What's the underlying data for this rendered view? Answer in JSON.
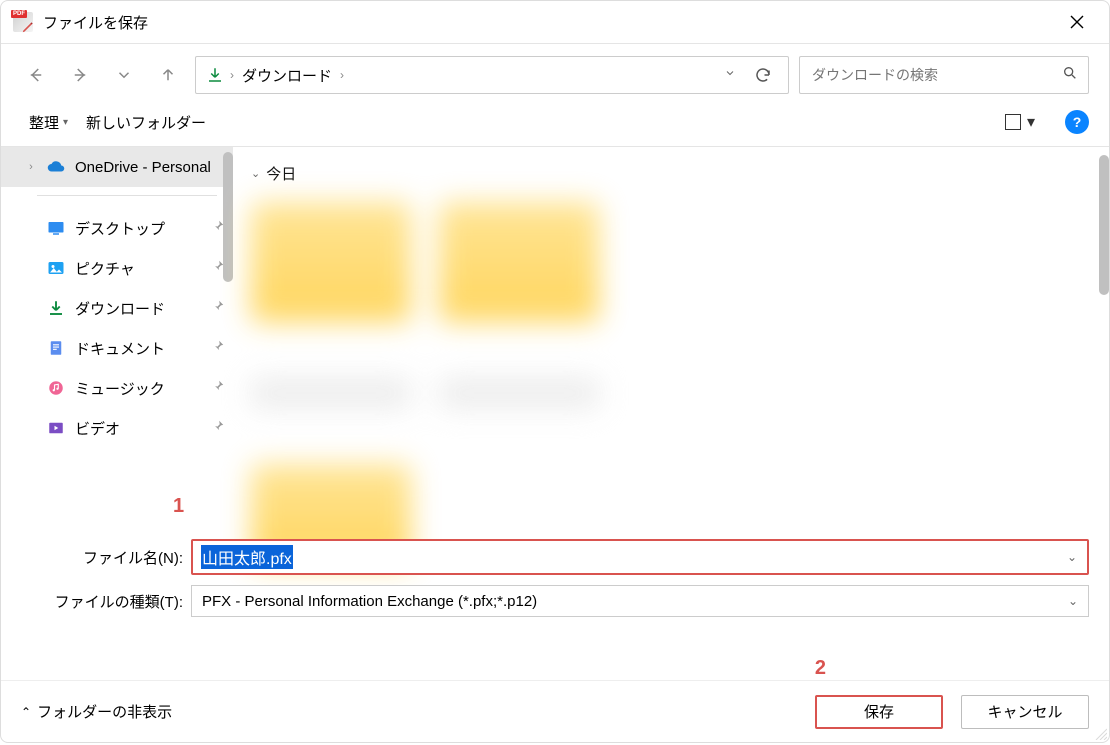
{
  "title": "ファイルを保存",
  "breadcrumb": {
    "item1": "ダウンロード"
  },
  "search": {
    "placeholder": "ダウンロードの検索"
  },
  "toolbar": {
    "organize": "整理",
    "newfolder": "新しいフォルダー"
  },
  "sidebar": {
    "onedrive": "OneDrive - Personal",
    "items": [
      {
        "label": "デスクトップ"
      },
      {
        "label": "ピクチャ"
      },
      {
        "label": "ダウンロード"
      },
      {
        "label": "ドキュメント"
      },
      {
        "label": "ミュージック"
      },
      {
        "label": "ビデオ"
      }
    ]
  },
  "content": {
    "group": "今日"
  },
  "filefields": {
    "name_label": "ファイル名(N):",
    "name_value": "山田太郎.pfx",
    "type_label": "ファイルの種類(T):",
    "type_value": "PFX - Personal Information Exchange (*.pfx;*.p12)"
  },
  "annotations": {
    "one": "1",
    "two": "2"
  },
  "footer": {
    "hide_folders": "フォルダーの非表示",
    "save": "保存",
    "cancel": "キャンセル"
  }
}
